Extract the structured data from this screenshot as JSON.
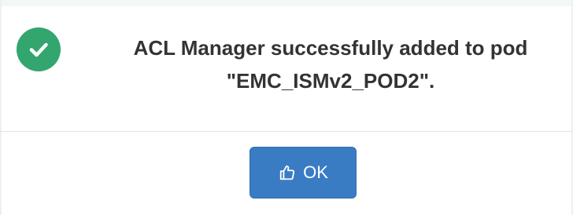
{
  "dialog": {
    "message_line1": "ACL Manager successfully added to pod",
    "message_line2": "\"EMC_ISMv2_POD2\".",
    "status_icon": "check-circle-icon",
    "ok_label": "OK",
    "ok_icon": "thumbs-up-icon"
  },
  "colors": {
    "success": "#32a66e",
    "primary_button": "#3a7cc4",
    "text": "#333333"
  }
}
